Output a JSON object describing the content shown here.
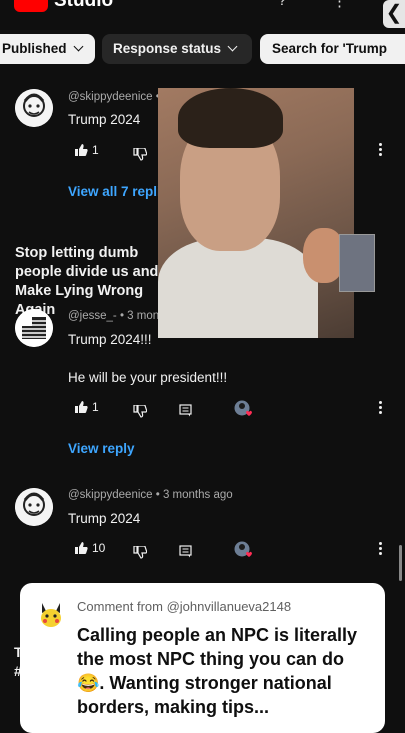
{
  "header": {
    "app_title": "Studio",
    "back_glyph": "❮"
  },
  "filters": {
    "published": "Published",
    "response_status": "Response status",
    "search": "Search for 'Trump"
  },
  "comments": [
    {
      "meta": "@skippydeenice • 3 months ago",
      "text": "Trump 2024",
      "likes": "1",
      "replies_link": "View all 7 replies"
    },
    {
      "meta": "@jesse_- • 3 months ago",
      "text": "Trump 2024!!!",
      "text2": "He will be your president!!!",
      "likes": "1",
      "replies_link": "View reply"
    },
    {
      "meta": "@skippydeenice • 3 months ago",
      "text": "Trump 2024",
      "likes": "10"
    }
  ],
  "video_heading": "Stop letting dumb people divide us and Make Lying Wrong Again",
  "below_popup_letters": "T\n#",
  "popup": {
    "icon": "pikachu-avatar",
    "from": "Comment from @johnvillanueva2148",
    "body": "Calling people an NPC is literally the most NPC thing you can do 😂. Wanting stronger national borders, making tips..."
  },
  "colors": {
    "background": "#0f0f0f",
    "link": "#3ea6ff",
    "logo_red": "#ff0000"
  },
  "icons": [
    "thumb-up-icon",
    "thumb-down-icon",
    "reply-icon",
    "creator-heart-icon",
    "more-vert-icon",
    "search-icon",
    "chevron-down-icon"
  ]
}
